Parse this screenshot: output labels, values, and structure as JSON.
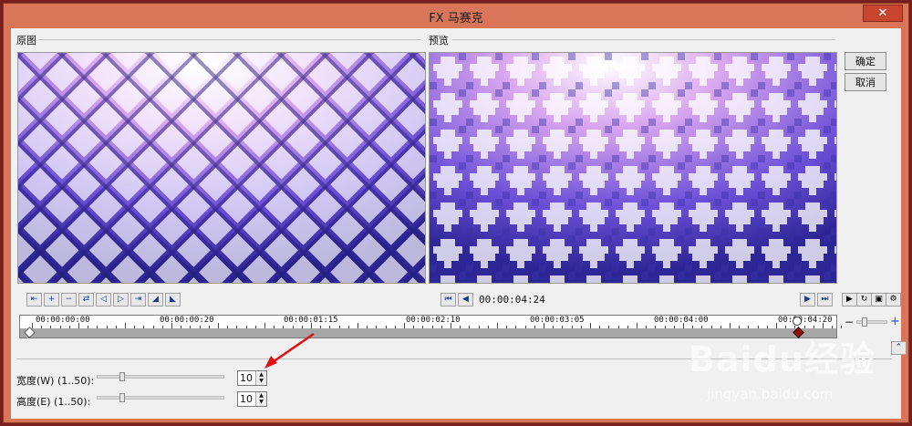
{
  "window": {
    "title": "FX 马赛克",
    "close_glyph": "✕"
  },
  "panels": {
    "original_label": "原图",
    "preview_label": "预览"
  },
  "buttons": {
    "ok": "确定",
    "cancel": "取消"
  },
  "preview": {
    "timecode": "00:00:04:24"
  },
  "timeline": {
    "labels": [
      "00:00:00:00",
      "00:00:00:20",
      "00:00:01:15",
      "00:00:02:10",
      "00:00:03:05",
      "00:00:04:00",
      "00:00:04:20"
    ]
  },
  "params": [
    {
      "label": "宽度(W) (1..50):",
      "value": "10"
    },
    {
      "label": "高度(E) (1..50):",
      "value": "10"
    }
  ],
  "zoom": {
    "minus": "−",
    "plus": "+"
  },
  "watermark": {
    "brand": "Baidu经验",
    "url": "jingyan.baidu.com"
  },
  "colors": {
    "tile_dark": "#3a2fa8",
    "tile_light": "#ffffff",
    "accent": "#2b55c9"
  }
}
